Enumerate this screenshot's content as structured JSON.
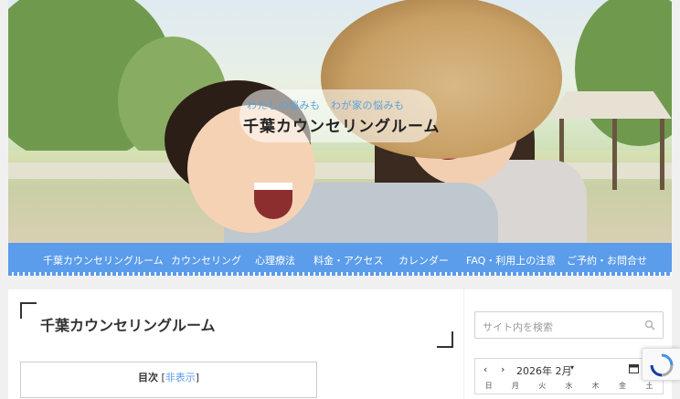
{
  "header": {
    "tagline": "わたしの悩みも　わが家の悩みも",
    "site_title": "千葉カウンセリングルーム"
  },
  "nav": {
    "items": [
      "千葉カウンセリングルーム",
      "カウンセリング",
      "心理療法",
      "料金・アクセス",
      "カレンダー",
      "FAQ・利用上の注意",
      "ご予約・お問合せ"
    ]
  },
  "main": {
    "page_title": "千葉カウンセリングルーム",
    "toc": {
      "title": "目次",
      "toggle_open": "[",
      "toggle": "非表示",
      "toggle_close": "]"
    }
  },
  "sidebar": {
    "search_placeholder": "サイト内を検索",
    "calendar": {
      "prev": "‹",
      "next": "›",
      "month": "2026年 2月",
      "dropdown": "▾",
      "weekdays": [
        "日",
        "月",
        "火",
        "水",
        "木",
        "金",
        "土"
      ]
    }
  },
  "colors": {
    "nav_bg": "#5b9ceb",
    "tagline": "#5aa3d8",
    "page_bg": "#f0f0f0"
  },
  "icons": {
    "search": "search-icon",
    "calendar": "calendar-icon",
    "recaptcha": "recaptcha-icon"
  }
}
